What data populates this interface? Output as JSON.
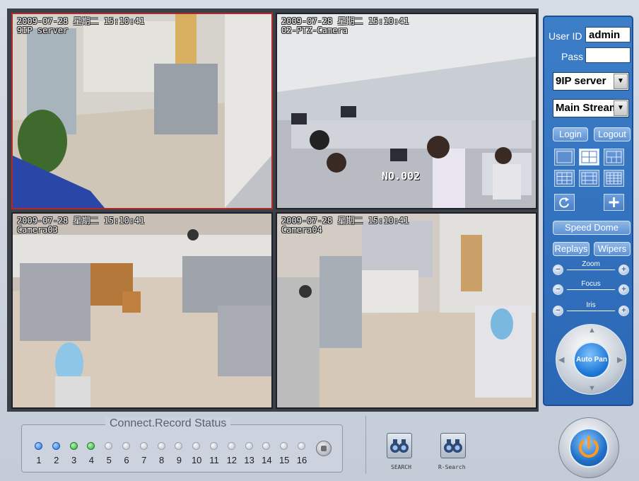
{
  "cameras": [
    {
      "timestamp": "2009-07-28 星期二 15:10:41",
      "name": "9IP server",
      "selected": true
    },
    {
      "timestamp": "2009-07-28 星期二 15:10:41",
      "name": "02-PTZ-Camera",
      "overlay_label": "NO.002",
      "selected": false
    },
    {
      "timestamp": "2009-07-28 星期二 15:10:41",
      "name": "Camera03",
      "selected": false
    },
    {
      "timestamp": "2009-07-28 星期二 15:10:41",
      "name": "Camera04",
      "selected": false
    }
  ],
  "panel": {
    "user_id_label": "User ID",
    "user_id_value": "admin",
    "pass_label": "Pass",
    "pass_value": "",
    "server_select": "9IP server",
    "stream_select": "Main Stream",
    "login": "Login",
    "logout": "Logout",
    "speed_dome": "Speed Dome",
    "replays": "Replays",
    "wipers": "Wipers",
    "zoom": "Zoom",
    "focus": "Focus",
    "iris": "Iris",
    "auto_pan": "Auto Pan"
  },
  "status": {
    "title": "Connect.Record Status",
    "channels": [
      "1",
      "2",
      "3",
      "4",
      "5",
      "6",
      "7",
      "8",
      "9",
      "10",
      "11",
      "12",
      "13",
      "14",
      "15",
      "16"
    ],
    "states": [
      "blue",
      "blue",
      "green",
      "green",
      "off",
      "off",
      "off",
      "off",
      "off",
      "off",
      "off",
      "off",
      "off",
      "off",
      "off",
      "off"
    ]
  },
  "tools": {
    "search": "SEARCH",
    "r_search": "R-Search"
  },
  "colors": {
    "panel_blue": "#2f6fbe",
    "selected_border": "#b02a2a",
    "connected": "#2a72d8",
    "recording": "#2ea83c"
  }
}
